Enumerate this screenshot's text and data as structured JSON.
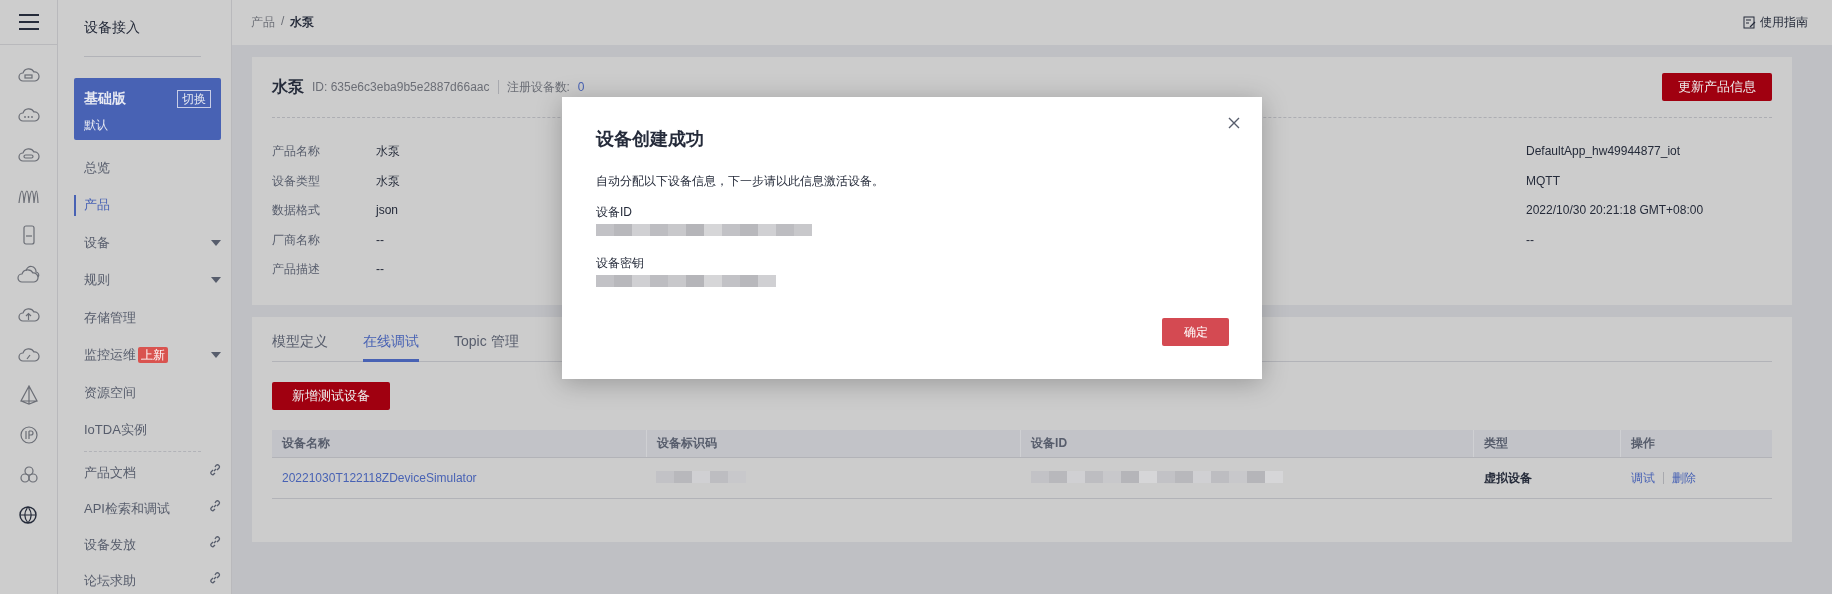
{
  "sidebar": {
    "title": "设备接入",
    "edition": {
      "name": "基础版",
      "switch": "切换",
      "instance": "默认"
    },
    "items": [
      {
        "label": "总览",
        "kind": "plain",
        "selected": false
      },
      {
        "label": "产品",
        "kind": "plain",
        "selected": true
      },
      {
        "label": "设备",
        "kind": "dropdown",
        "selected": false
      },
      {
        "label": "规则",
        "kind": "dropdown",
        "selected": false
      },
      {
        "label": "存储管理",
        "kind": "plain",
        "selected": false
      },
      {
        "label": "监控运维",
        "kind": "dropdown",
        "badge": "上新",
        "selected": false
      },
      {
        "label": "资源空间",
        "kind": "plain",
        "selected": false
      },
      {
        "label": "IoTDA实例",
        "kind": "plain",
        "selected": false
      }
    ],
    "links": [
      "产品文档",
      "API检索和调试",
      "设备发放",
      "论坛求助"
    ]
  },
  "breadcrumb": {
    "items": [
      "产品",
      "水泵"
    ],
    "separator": "/"
  },
  "guide": "使用指南",
  "product": {
    "name": "水泵",
    "id": "ID: 635e6c3eba9b5e2887d66aac",
    "count_label": "注册设备数:",
    "count": "0",
    "update_button": "更新产品信息",
    "fields": [
      {
        "label": "产品名称",
        "value": "水泵"
      },
      {
        "label": "设备类型",
        "value": "水泵"
      },
      {
        "label": "数据格式",
        "value": "json"
      },
      {
        "label": "厂商名称",
        "value": "--"
      },
      {
        "label": "产品描述",
        "value": "--"
      }
    ],
    "right_values": [
      "DefaultApp_hw49944877_iot",
      "MQTT",
      "2022/10/30 20:21:18 GMT+08:00",
      "--"
    ]
  },
  "debug": {
    "tabs": [
      {
        "label": "模型定义",
        "selected": false
      },
      {
        "label": "在线调试",
        "selected": true
      },
      {
        "label": "Topic 管理",
        "selected": false
      }
    ],
    "add_button": "新增测试设备",
    "columns": [
      "设备名称",
      "设备标识码",
      "设备ID",
      "类型",
      "操作"
    ],
    "rows": [
      {
        "cells": [
          {
            "kind": "link",
            "text": "20221030T122118ZDeviceSimulator"
          },
          {
            "kind": "redacted"
          },
          {
            "kind": "redacted"
          },
          {
            "kind": "text",
            "text": "虚拟设备"
          },
          {
            "kind": "actions",
            "actions": [
              "调试",
              "删除"
            ]
          }
        ]
      }
    ]
  },
  "dialog": {
    "title": "设备创建成功",
    "message": "自动分配以下设备信息，下一步请以此信息激活设备。",
    "fields": [
      "设备ID",
      "设备密钥"
    ],
    "confirm": "确定"
  }
}
